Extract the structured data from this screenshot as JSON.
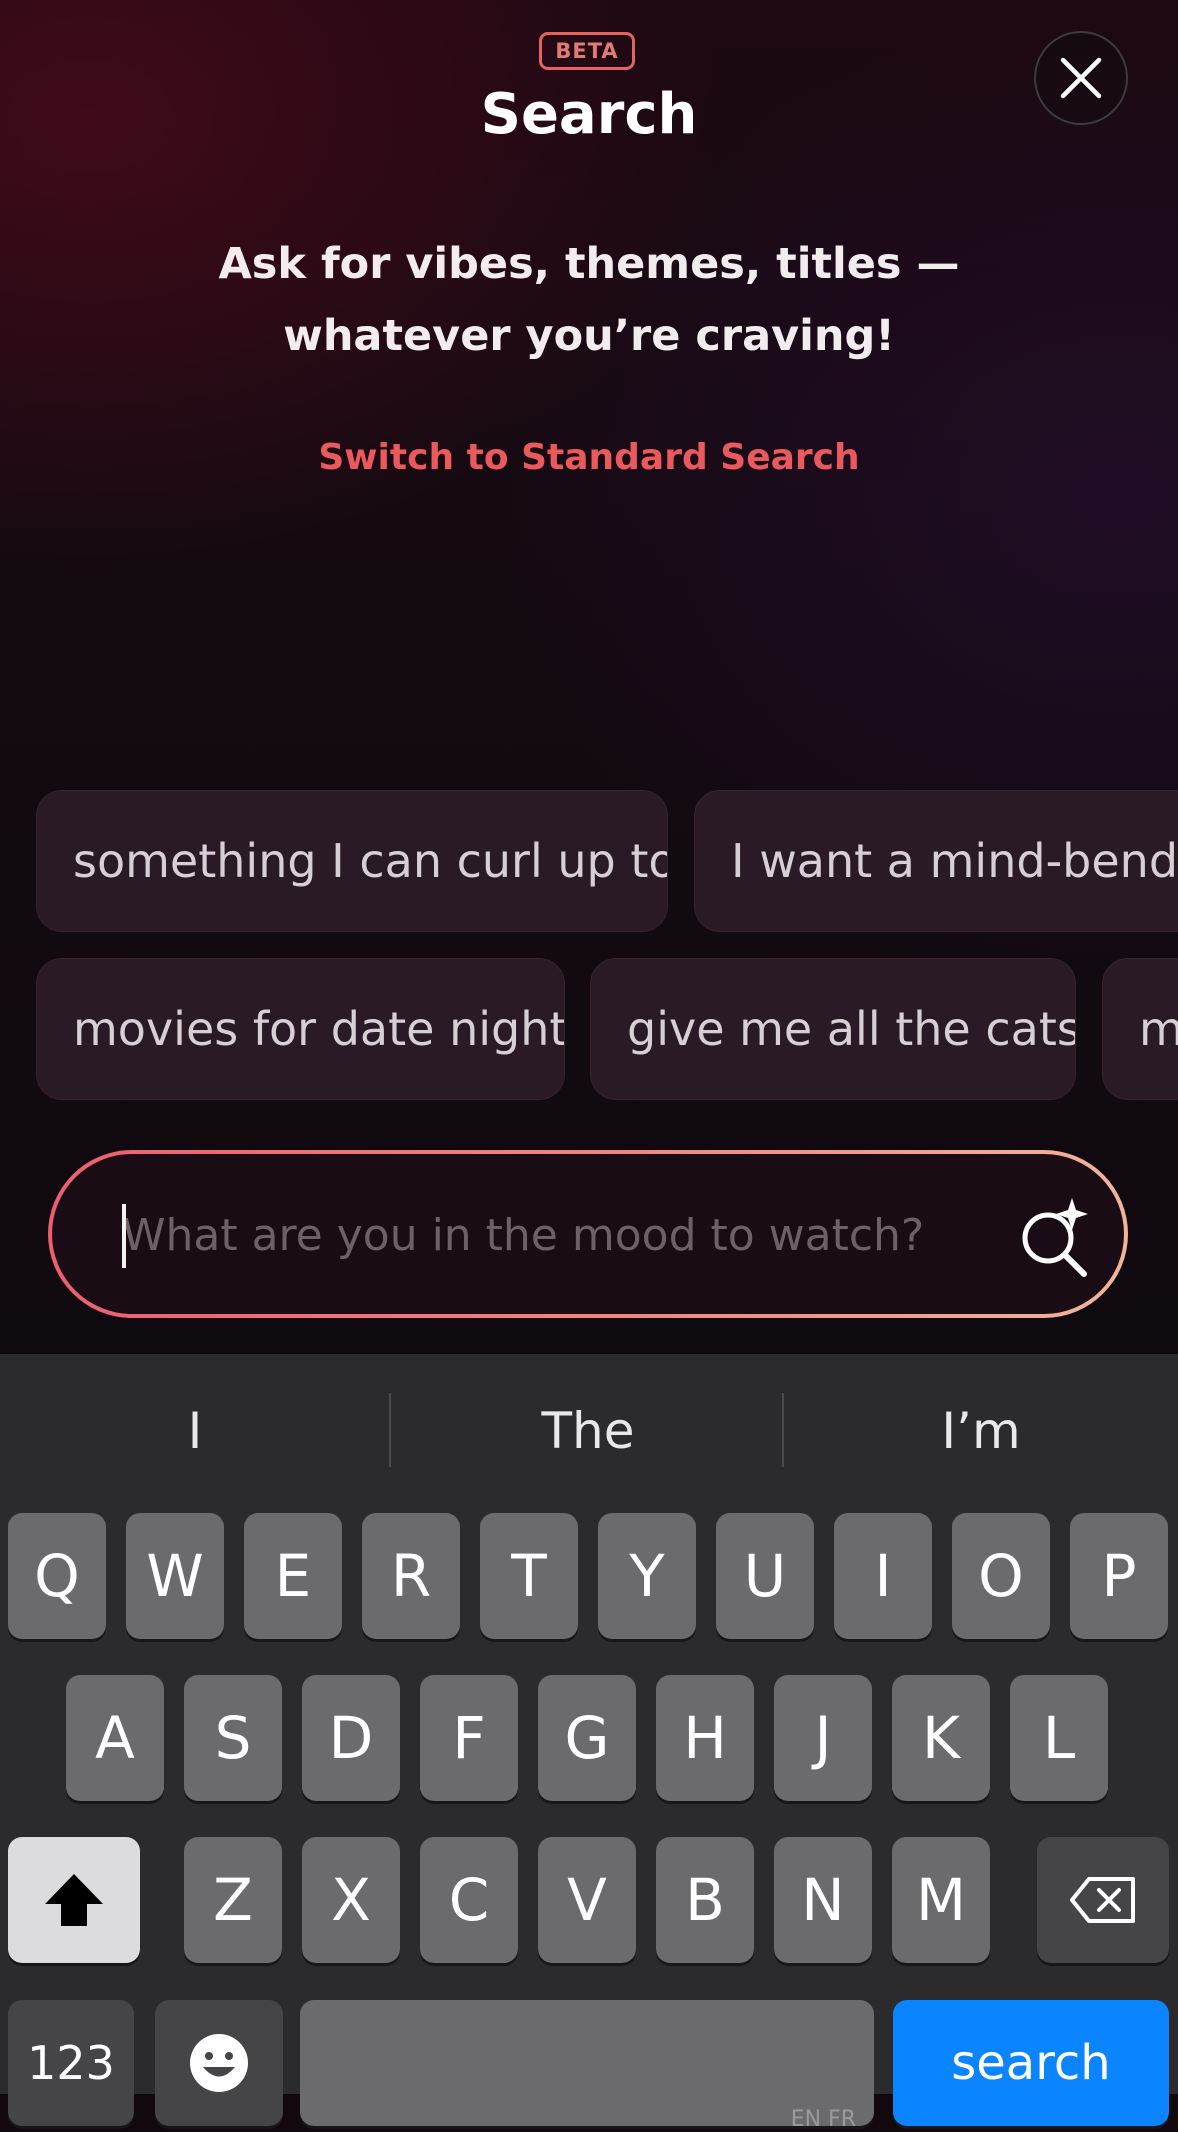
{
  "header": {
    "badge": "BETA",
    "title": "Search",
    "subtitle": "Ask for vibes, themes, titles — whatever you’re craving!",
    "switch_link": "Switch to Standard Search"
  },
  "suggestions": {
    "row1": [
      "something I can curl up to",
      "I want a mind-bendin"
    ],
    "row2": [
      "movies for date night",
      "give me all the cats",
      "m"
    ]
  },
  "search": {
    "placeholder": "What are you in the mood to watch?",
    "value": ""
  },
  "keyboard": {
    "predictions": [
      "I",
      "The",
      "I’m"
    ],
    "row1": [
      "Q",
      "W",
      "E",
      "R",
      "T",
      "Y",
      "U",
      "I",
      "O",
      "P"
    ],
    "row2": [
      "A",
      "S",
      "D",
      "F",
      "G",
      "H",
      "J",
      "K",
      "L"
    ],
    "row3": [
      "Z",
      "X",
      "C",
      "V",
      "B",
      "N",
      "M"
    ],
    "numbers_key": "123",
    "go_key": "search",
    "space_language": "EN FR"
  },
  "colors": {
    "accent_red": "#ea5a5d",
    "keyboard_blue": "#0a84ff"
  },
  "icons": {
    "close": "close-icon",
    "search": "ai-search-icon",
    "shift": "shift-icon",
    "backspace": "backspace-icon",
    "emoji": "emoji-icon"
  }
}
